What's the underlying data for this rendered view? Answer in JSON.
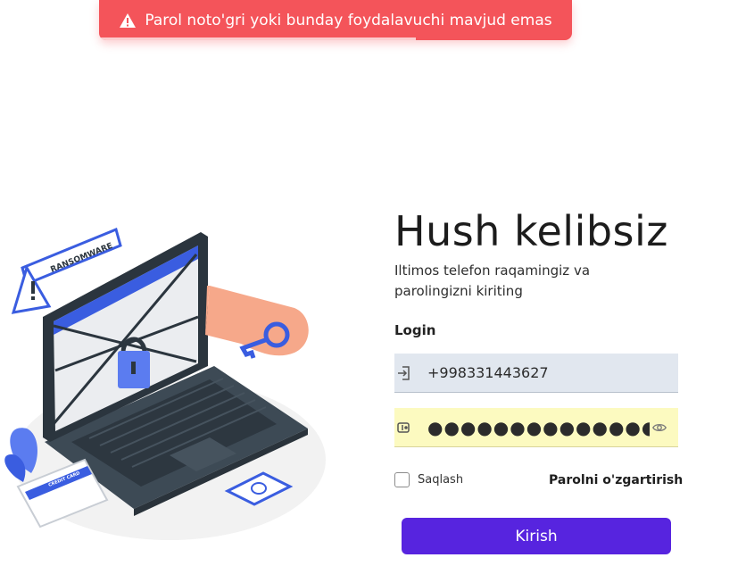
{
  "toast": {
    "message": "Parol noto'gri yoki bunday foydalavuchi mavjud emas",
    "icon": "warning-icon",
    "progress": 0.67,
    "color": "#f4545a"
  },
  "illustration": {
    "sign_text": "RANSOMWARE",
    "card_text": "CREDIT CARD"
  },
  "form": {
    "title": "Hush kelibsiz",
    "subtitle": "Iltimos telefon raqamingiz va parolingizni kiriting",
    "login_label": "Login",
    "phone_value": "+998331443627",
    "phone_icon": "login-icon",
    "password_value": "●●●●●●●●●●●●●●●●●",
    "password_icon": "key-icon",
    "show_password_icon": "eye-icon",
    "remember_label": "Saqlash",
    "remember_checked": false,
    "change_password_label": "Parolni o'zgartirish",
    "submit_label": "Kirish",
    "accent_color": "#5724df"
  }
}
